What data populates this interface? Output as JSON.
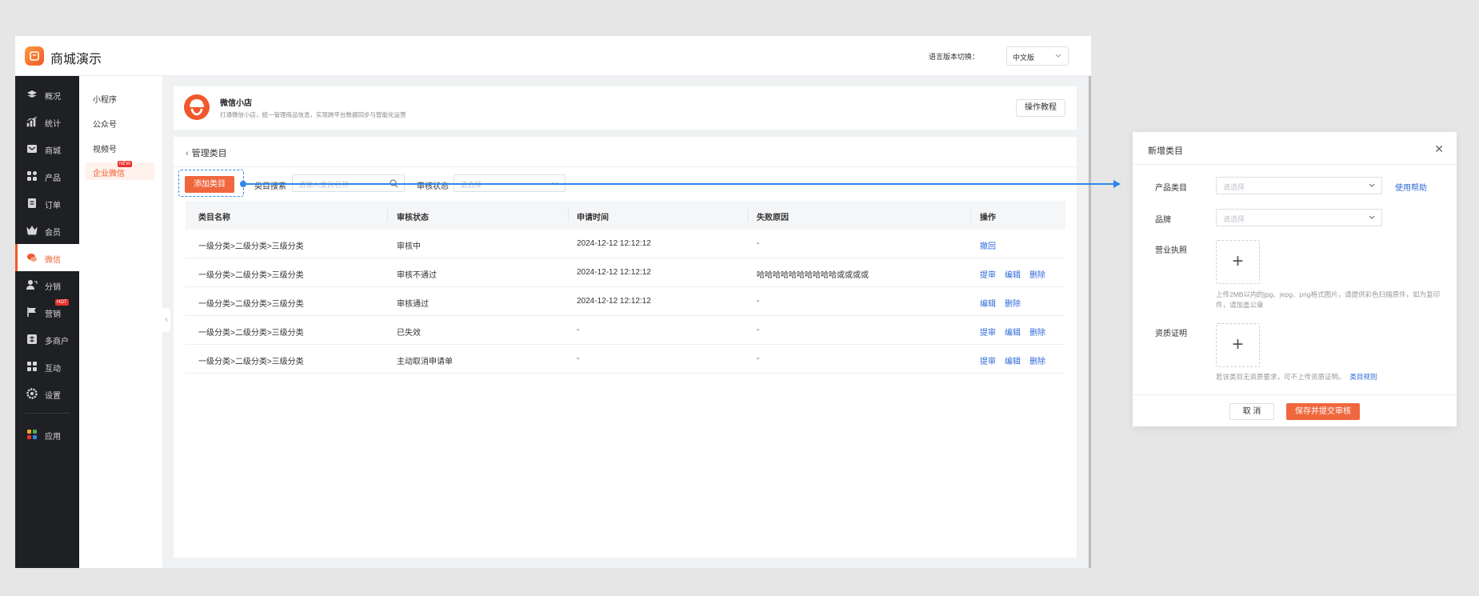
{
  "app": {
    "title": "商城演示",
    "lang_label": "语言版本切换：",
    "lang_value": "中文版"
  },
  "sidebar": {
    "items": [
      {
        "label": "概况",
        "icon": "layers-icon"
      },
      {
        "label": "统计",
        "icon": "chart-icon"
      },
      {
        "label": "商城",
        "icon": "store-icon"
      },
      {
        "label": "产品",
        "icon": "grid-icon"
      },
      {
        "label": "订单",
        "icon": "clipboard-icon"
      },
      {
        "label": "会员",
        "icon": "crown-icon"
      },
      {
        "label": "微信",
        "icon": "wechat-icon"
      },
      {
        "label": "分销",
        "icon": "user-share-icon"
      },
      {
        "label": "营销",
        "icon": "flag-icon",
        "badge": "HOT"
      },
      {
        "label": "多商户",
        "icon": "multi-store-icon"
      },
      {
        "label": "互动",
        "icon": "apps-icon"
      },
      {
        "label": "设置",
        "icon": "gear-icon"
      },
      {
        "label": "应用",
        "icon": "colorful-apps-icon"
      }
    ]
  },
  "subnav": {
    "items": [
      "小程序",
      "公众号",
      "视频号",
      "企业微信"
    ],
    "new_badge": "NEW"
  },
  "shop": {
    "title": "微信小店",
    "desc": "打通微信小店，统一管理商品信息，实现跨平台数据同步与智能化运营",
    "tutorial": "操作教程"
  },
  "page": {
    "back_title": "管理类目",
    "add_button": "添加类目",
    "search_label": "类目搜索",
    "search_placeholder": "请输入类目名称",
    "status_label": "审核状态",
    "status_placeholder": "请选择"
  },
  "table": {
    "headers": [
      "类目名称",
      "审核状态",
      "申请时间",
      "失败原因",
      "操作"
    ],
    "rows": [
      {
        "name": "一级分类>二级分类>三级分类",
        "status": "审核中",
        "time": "2024-12-12 12:12:12",
        "reason": "-",
        "actions": [
          "撤回"
        ]
      },
      {
        "name": "一级分类>二级分类>三级分类",
        "status": "审核不通过",
        "time": "2024-12-12 12:12:12",
        "reason": "哈哈哈哈哈哈哈哈哈哈或或或或",
        "actions": [
          "提审",
          "编辑",
          "删除"
        ]
      },
      {
        "name": "一级分类>二级分类>三级分类",
        "status": "审核通过",
        "time": "2024-12-12 12:12:12",
        "reason": "-",
        "actions": [
          "编辑",
          "删除"
        ]
      },
      {
        "name": "一级分类>二级分类>三级分类",
        "status": "已失效",
        "time": "-",
        "reason": "-",
        "actions": [
          "提审",
          "编辑",
          "删除"
        ]
      },
      {
        "name": "一级分类>二级分类>三级分类",
        "status": "主动取消申请单",
        "time": "-",
        "reason": "-",
        "actions": [
          "提审",
          "编辑",
          "删除"
        ]
      }
    ]
  },
  "dialog": {
    "title": "新增类目",
    "product_category_label": "产品类目",
    "product_category_placeholder": "请选择",
    "help": "使用帮助",
    "brand_label": "品牌",
    "brand_placeholder": "请选择",
    "license_label": "营业执照",
    "license_hint": "上传2MB以内的jpg、jepg、png格式图片，请提供彩色扫描原件，如为复印件，请加盖公章",
    "qualification_label": "资质证明",
    "qualification_hint": "若该类目无资质要求，可不上传资质证明。",
    "qualification_link": "类目规则",
    "cancel": "取 消",
    "submit": "保存并提交审核"
  },
  "colors": {
    "accent": "#f0673e",
    "link": "#2f6ad8",
    "connector": "#2f86e8",
    "sidebar": "#1f2024"
  }
}
